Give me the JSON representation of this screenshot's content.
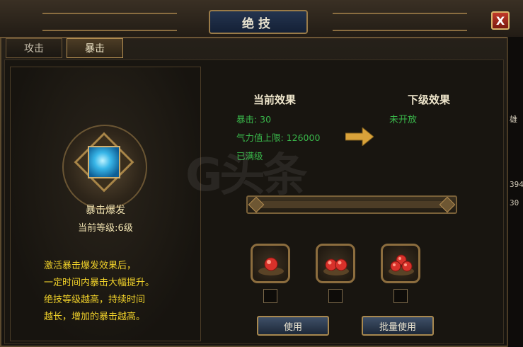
{
  "window": {
    "title": "绝技",
    "close_label": "X"
  },
  "tabs": [
    {
      "label": "攻击",
      "active": false
    },
    {
      "label": "暴击",
      "active": true
    }
  ],
  "skill": {
    "name": "暴击爆发",
    "level_text": "当前等级:6级",
    "description": [
      "激活暴击爆发效果后，",
      "一定时间内暴击大幅提升。",
      "绝技等级越高，持续时间",
      "越长，增加的暴击越高。"
    ]
  },
  "current_effect": {
    "header": "当前效果",
    "lines": [
      "暴击: 30",
      "气力值上限: 126000",
      "已满级"
    ]
  },
  "next_effect": {
    "header": "下级效果",
    "lines": [
      "未开放"
    ]
  },
  "watermark": "G头条",
  "side_strip": [
    "雄",
    "394",
    "30"
  ],
  "items": [
    {
      "name": "single-orb",
      "count": 1
    },
    {
      "name": "double-orb",
      "count": 2
    },
    {
      "name": "triple-orb",
      "count": 3
    }
  ],
  "buttons": {
    "use": "使用",
    "batch_use": "批量使用"
  },
  "colors": {
    "accent_green": "#39b64a",
    "desc_yellow": "#f0d12a",
    "gold_border": "#a8884f"
  }
}
